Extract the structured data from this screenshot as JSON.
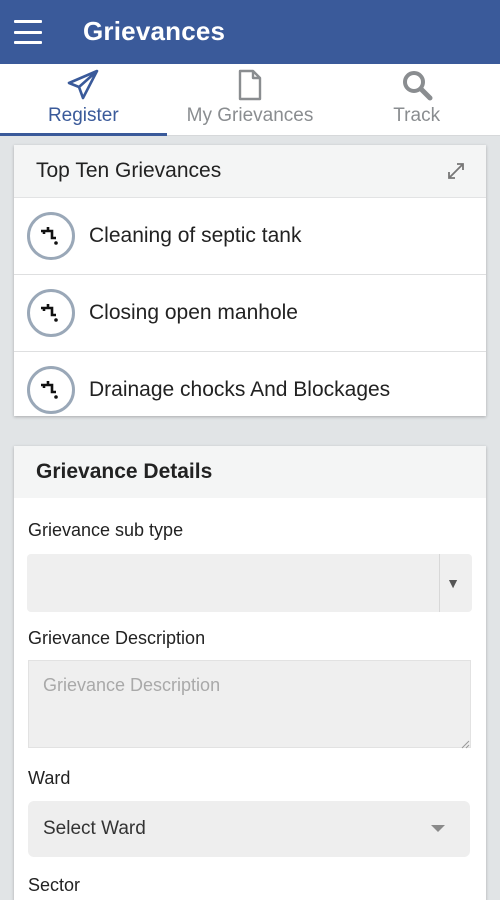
{
  "appbar": {
    "title": "Grievances"
  },
  "tabs": [
    {
      "label": "Register",
      "icon": "paper-plane-icon",
      "active": true
    },
    {
      "label": "My Grievances",
      "icon": "document-icon",
      "active": false
    },
    {
      "label": "Track",
      "icon": "search-icon",
      "active": false
    }
  ],
  "top_grievances": {
    "title": "Top Ten Grievances",
    "items": [
      {
        "label": "Cleaning of septic tank",
        "icon": "drain-pipe-icon"
      },
      {
        "label": "Closing open manhole",
        "icon": "drain-pipe-icon"
      },
      {
        "label": "Drainage chocks And Blockages",
        "icon": "drain-pipe-icon"
      }
    ]
  },
  "details": {
    "title": "Grievance Details",
    "subtype_label": "Grievance sub type",
    "subtype_value": "",
    "description_label": "Grievance Description",
    "description_placeholder": "Grievance Description",
    "ward_label": "Ward",
    "ward_value": "Select Ward",
    "sector_label": "Sector"
  },
  "colors": {
    "primary": "#3a5a9a",
    "background": "#e1e4e6",
    "card_header": "#f4f5f5"
  }
}
